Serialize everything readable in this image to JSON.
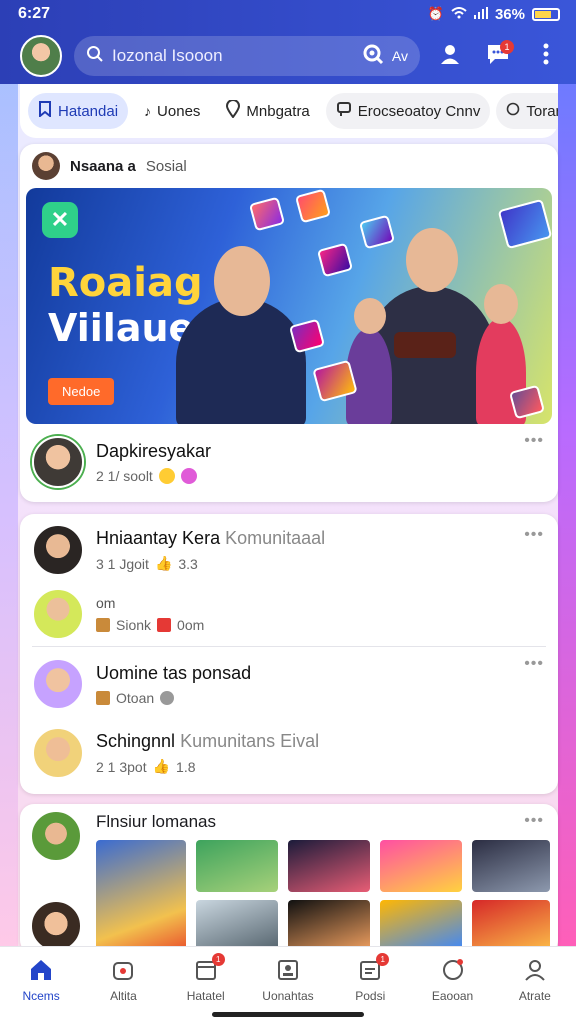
{
  "status": {
    "time": "6:27",
    "battery": "36%"
  },
  "search": {
    "query": "Iozonal Isooon",
    "right_label": "Av"
  },
  "header": {
    "notif_count": "1"
  },
  "chips": [
    {
      "label": "Hatandai"
    },
    {
      "label": "Uones"
    },
    {
      "label": "Mnbgatra"
    },
    {
      "label": "Erocseoatoy Cnnv"
    },
    {
      "label": "Toran"
    }
  ],
  "featured": {
    "author": "Nsaana a",
    "tag": "Sosial",
    "banner_title_1": "Roaiag",
    "banner_title_2": "Viilaue",
    "banner_button": "Nedoe",
    "post_title": "Dapkiresyakar",
    "post_meta": "2 1/ soolt"
  },
  "posts": [
    {
      "title": "Hniaantay Kera",
      "title_suffix": "Komunitaaal",
      "meta": "3 1 Jgoit",
      "meta2": "3.3"
    },
    {
      "title": "om",
      "meta": "Sionk",
      "meta2": "0om"
    },
    {
      "title": "Uomine tas ponsad",
      "meta": "Otoan"
    },
    {
      "title": "Schingnnl",
      "title_suffix": "Kumunitans Eival",
      "meta": "2 1 3pot",
      "meta2": "1.8"
    }
  ],
  "gallery": {
    "title": "Flnsiur lomanas"
  },
  "nav": [
    {
      "label": "Ncems",
      "badge": ""
    },
    {
      "label": "Altita",
      "badge": ""
    },
    {
      "label": "Hatatel",
      "badge": "1"
    },
    {
      "label": "Uonahtas",
      "badge": ""
    },
    {
      "label": "Podsi",
      "badge": "1"
    },
    {
      "label": "Eaooan",
      "badge": ""
    },
    {
      "label": "Atrate",
      "badge": ""
    }
  ],
  "colors": {
    "primary": "#2c3fb6",
    "accent": "#2345c9",
    "badge": "#e53935",
    "cta": "#ff6a2a"
  }
}
